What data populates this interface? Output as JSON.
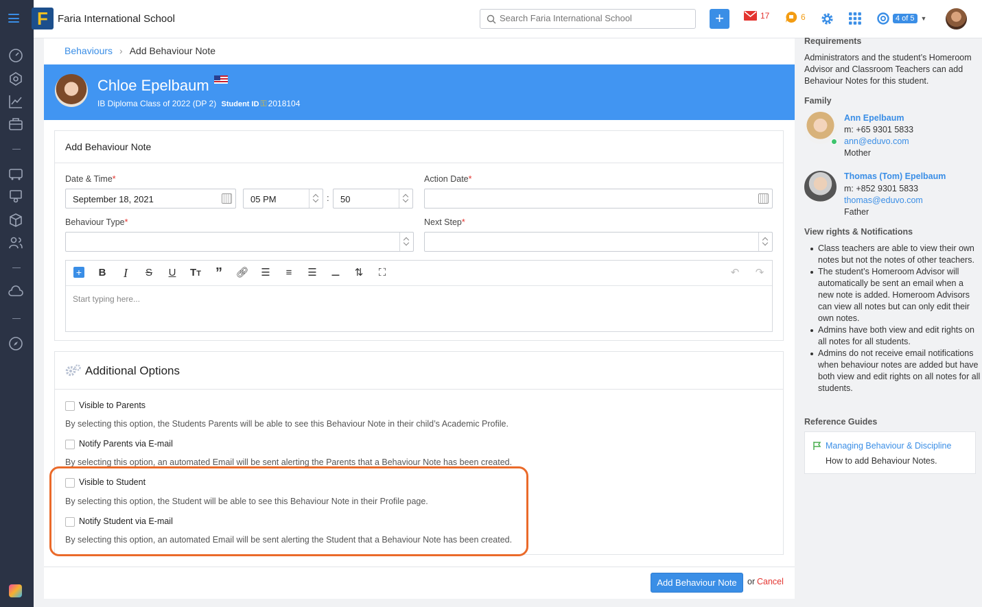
{
  "header": {
    "school_name": "Faria International School",
    "search_placeholder": "Search Faria International School",
    "mail_count": "17",
    "chat_count": "6",
    "pager": "4 of 5"
  },
  "breadcrumb": {
    "parent": "Behaviours",
    "current": "Add Behaviour Note"
  },
  "student": {
    "name": "Chloe Epelbaum",
    "class": "IB Diploma Class of 2022 (DP 2)",
    "id_label": "Student ID",
    "id": "2018104"
  },
  "form": {
    "title": "Add Behaviour Note",
    "date_label": "Date & Time",
    "date_value": "September 18, 2021",
    "hour_value": "05 PM",
    "minute_value": "50",
    "action_date_label": "Action Date",
    "behaviour_type_label": "Behaviour Type",
    "next_step_label": "Next Step",
    "editor_placeholder": "Start typing here..."
  },
  "options": {
    "title": "Additional Options",
    "items": [
      {
        "label": "Visible to Parents",
        "desc": "By selecting this option, the Students Parents will be able to see this Behaviour Note in their child’s Academic Profile."
      },
      {
        "label": "Notify Parents via E-mail",
        "desc": "By selecting this option, an automated Email will be sent alerting the Parents that a Behaviour Note has been created."
      },
      {
        "label": "Visible to Student",
        "desc": "By selecting this option, the Student will be able to see this Behaviour Note in their Profile page."
      },
      {
        "label": "Notify Student via E-mail",
        "desc": "By selecting this option, an automated Email will be sent alerting the Student that a Behaviour Note has been created."
      }
    ]
  },
  "actions": {
    "submit": "Add Behaviour Note",
    "or": "or",
    "cancel": "Cancel"
  },
  "right_panel": {
    "requirements_title": "Requirements",
    "requirements_text": "Administrators and the student’s Homeroom Advisor and Classroom Teachers can add Behaviour Notes for this student.",
    "family_title": "Family",
    "family": [
      {
        "name": "Ann Epelbaum",
        "phone": "m: +65 9301 5833",
        "email": "ann@eduvo.com",
        "relation": "Mother"
      },
      {
        "name": "Thomas (Tom) Epelbaum",
        "phone": "m: +852 9301 5833",
        "email": "thomas@eduvo.com",
        "relation": "Father"
      }
    ],
    "rights_title": "View rights & Notifications",
    "rights": [
      "Class teachers are able to view their own notes but not the notes of other teachers.",
      "The student’s Homeroom Advisor will automatically be sent an email when a new note is added. Homeroom Advisors can view all notes but can only edit their own notes.",
      "Admins have both view and edit rights on all notes for all students.",
      "Admins do not receive email notifications when behaviour notes are added but have both view and edit rights on all notes for all students."
    ],
    "guides_title": "Reference Guides",
    "guide_link": "Managing Behaviour & Discipline",
    "guide_desc": "How to add Behaviour Notes."
  },
  "colors": {
    "accent": "#3a8ee6",
    "banner": "#4195f2",
    "sidebar": "#2b3345",
    "highlight": "#ea6a2a",
    "required": "#e3342f"
  }
}
